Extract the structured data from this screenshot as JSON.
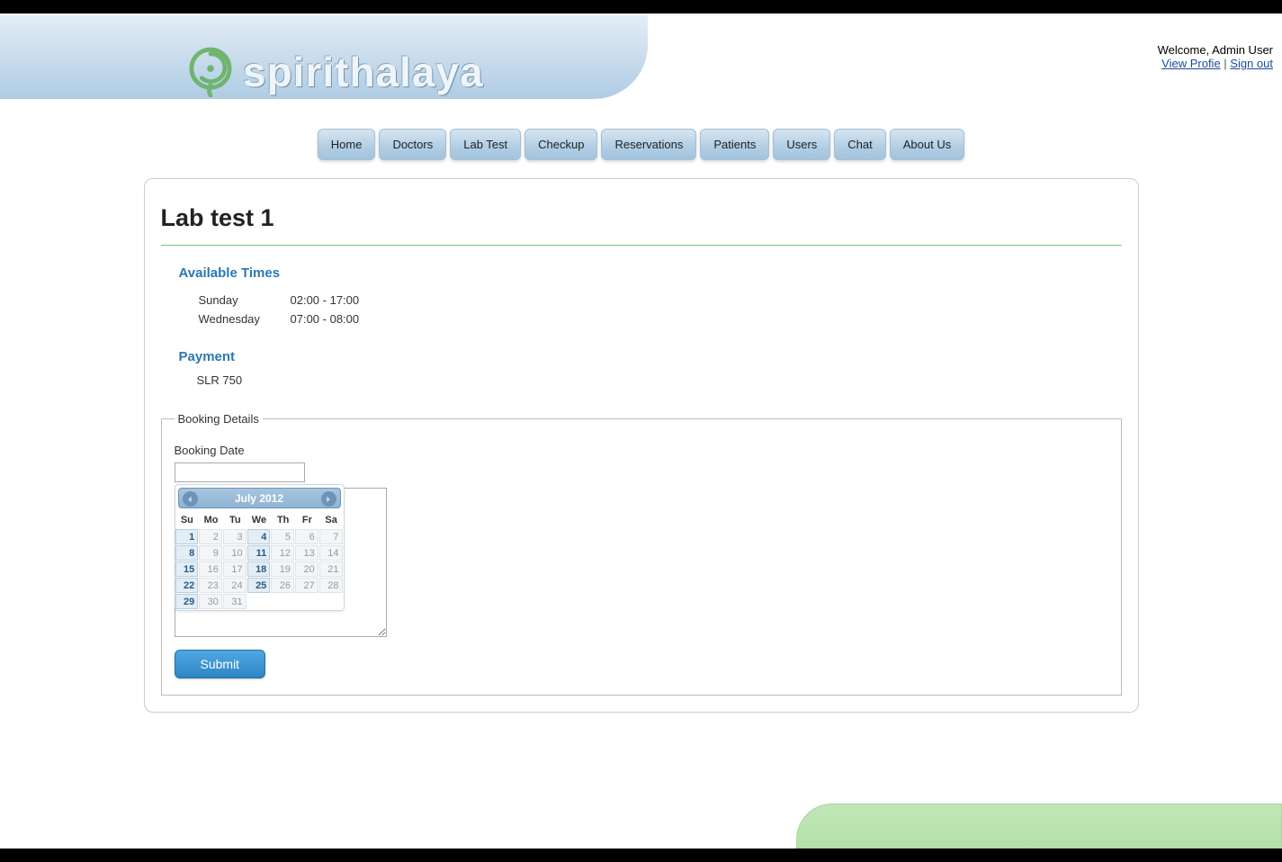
{
  "header": {
    "brand": "spirithalaya",
    "welcome": "Welcome, Admin User",
    "view_profile": "View Profie",
    "sign_out": "Sign out"
  },
  "nav": {
    "items": [
      "Home",
      "Doctors",
      "Lab Test",
      "Checkup",
      "Reservations",
      "Patients",
      "Users",
      "Chat",
      "About Us"
    ]
  },
  "page": {
    "title": "Lab test 1",
    "available_times_heading": "Available Times",
    "times": [
      {
        "day": "Sunday",
        "range": "02:00 - 17:00"
      },
      {
        "day": "Wednesday",
        "range": "07:00 - 08:00"
      }
    ],
    "payment_heading": "Payment",
    "payment_value": "SLR 750"
  },
  "booking": {
    "legend": "Booking Details",
    "date_label": "Booking Date",
    "date_value": "",
    "notes_value": "",
    "submit_label": "Submit"
  },
  "datepicker": {
    "title": "July 2012",
    "weekdays": [
      "Su",
      "Mo",
      "Tu",
      "We",
      "Th",
      "Fr",
      "Sa"
    ],
    "weeks": [
      [
        {
          "d": "1",
          "on": true
        },
        {
          "d": "2",
          "on": false
        },
        {
          "d": "3",
          "on": false
        },
        {
          "d": "4",
          "on": true
        },
        {
          "d": "5",
          "on": false
        },
        {
          "d": "6",
          "on": false
        },
        {
          "d": "7",
          "on": false
        }
      ],
      [
        {
          "d": "8",
          "on": true
        },
        {
          "d": "9",
          "on": false
        },
        {
          "d": "10",
          "on": false
        },
        {
          "d": "11",
          "on": true
        },
        {
          "d": "12",
          "on": false
        },
        {
          "d": "13",
          "on": false
        },
        {
          "d": "14",
          "on": false
        }
      ],
      [
        {
          "d": "15",
          "on": true
        },
        {
          "d": "16",
          "on": false
        },
        {
          "d": "17",
          "on": false
        },
        {
          "d": "18",
          "on": true
        },
        {
          "d": "19",
          "on": false
        },
        {
          "d": "20",
          "on": false
        },
        {
          "d": "21",
          "on": false
        }
      ],
      [
        {
          "d": "22",
          "on": true
        },
        {
          "d": "23",
          "on": false
        },
        {
          "d": "24",
          "on": false
        },
        {
          "d": "25",
          "on": true
        },
        {
          "d": "26",
          "on": false
        },
        {
          "d": "27",
          "on": false
        },
        {
          "d": "28",
          "on": false
        }
      ],
      [
        {
          "d": "29",
          "on": true
        },
        {
          "d": "30",
          "on": false
        },
        {
          "d": "31",
          "on": false
        },
        {
          "d": "",
          "on": false
        },
        {
          "d": "",
          "on": false
        },
        {
          "d": "",
          "on": false
        },
        {
          "d": "",
          "on": false
        }
      ]
    ]
  }
}
